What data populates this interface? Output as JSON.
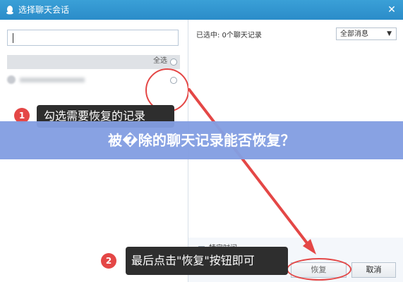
{
  "window": {
    "title": "选择聊天会话",
    "close_glyph": "✕",
    "title_icon": "penguin-icon"
  },
  "left_panel": {
    "search": {
      "value": "",
      "placeholder": ""
    },
    "select_all_label": "全选"
  },
  "right_panel": {
    "selected_count_text": "已选中: 0个聊天记录",
    "filter": {
      "value": "全部消息",
      "arrow_glyph": "▼"
    }
  },
  "footer": {
    "checkbox_label": "特定时间",
    "restore_label": "恢复",
    "cancel_label": "取消"
  },
  "instructions": {
    "step1_badge": "1",
    "step1_text": "勾选需要恢复的记录",
    "step2_badge": "2",
    "step2_text": "最后点击\"恢复\"按钮即可"
  },
  "banner": {
    "text": "被�除的聊天记录能否恢复？"
  },
  "colors": {
    "titlebar": "#2f94cf",
    "annotation": "#e44746",
    "banner": "#839ee2",
    "panel_bg": "#f4f7fb"
  }
}
